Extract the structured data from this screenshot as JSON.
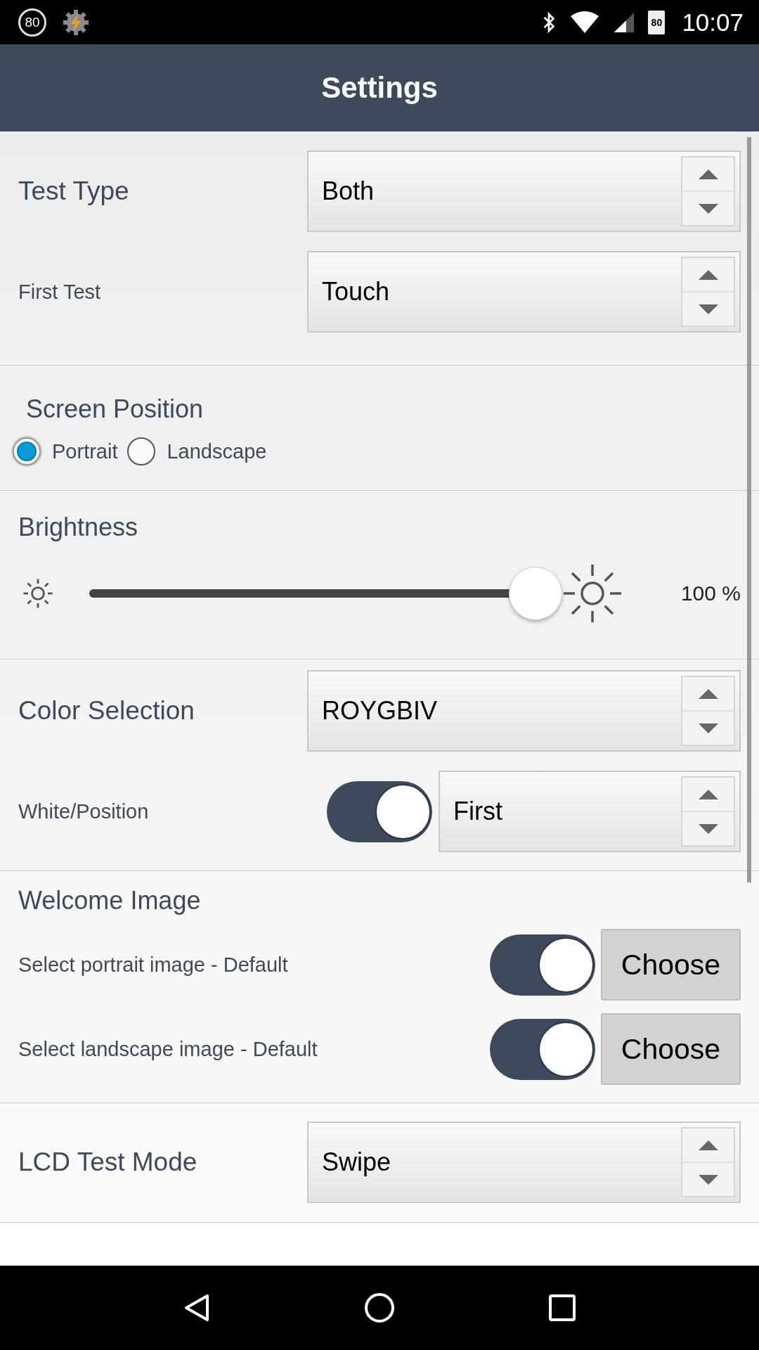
{
  "status_bar": {
    "left_badge": "80",
    "battery": "80",
    "time": "10:07"
  },
  "title": "Settings",
  "sections": [
    {
      "rows": [
        {
          "kind": "main_spinner",
          "label": "Test Type",
          "value": "Both"
        },
        {
          "kind": "sub_spinner",
          "label": "First Test",
          "value": "Touch"
        }
      ]
    },
    {
      "heading": "Screen Position",
      "rows": [
        {
          "kind": "radio",
          "options": [
            {
              "label": "Portrait",
              "selected": true
            },
            {
              "label": "Landscape",
              "selected": false
            }
          ]
        }
      ]
    },
    {
      "heading": "Brightness",
      "rows": [
        {
          "kind": "slider",
          "level": 1.0,
          "reading": "100 %"
        }
      ]
    },
    {
      "rows": [
        {
          "kind": "main_spinner",
          "label": "Color Selection",
          "value": "ROYGBIV"
        },
        {
          "kind": "toggle_spinner",
          "label": "White/Position",
          "on": true,
          "value": "First"
        }
      ]
    },
    {
      "heading": "Welcome Image",
      "rows": [
        {
          "kind": "toggle_button",
          "label": "Select portrait image - Default",
          "on": true,
          "button": "Choose"
        },
        {
          "kind": "toggle_button",
          "label": "Select landscape image - Default",
          "on": true,
          "button": "Choose"
        }
      ]
    },
    {
      "rows": [
        {
          "kind": "main_spinner",
          "label": "LCD Test Mode",
          "value": "Swipe"
        }
      ]
    }
  ]
}
